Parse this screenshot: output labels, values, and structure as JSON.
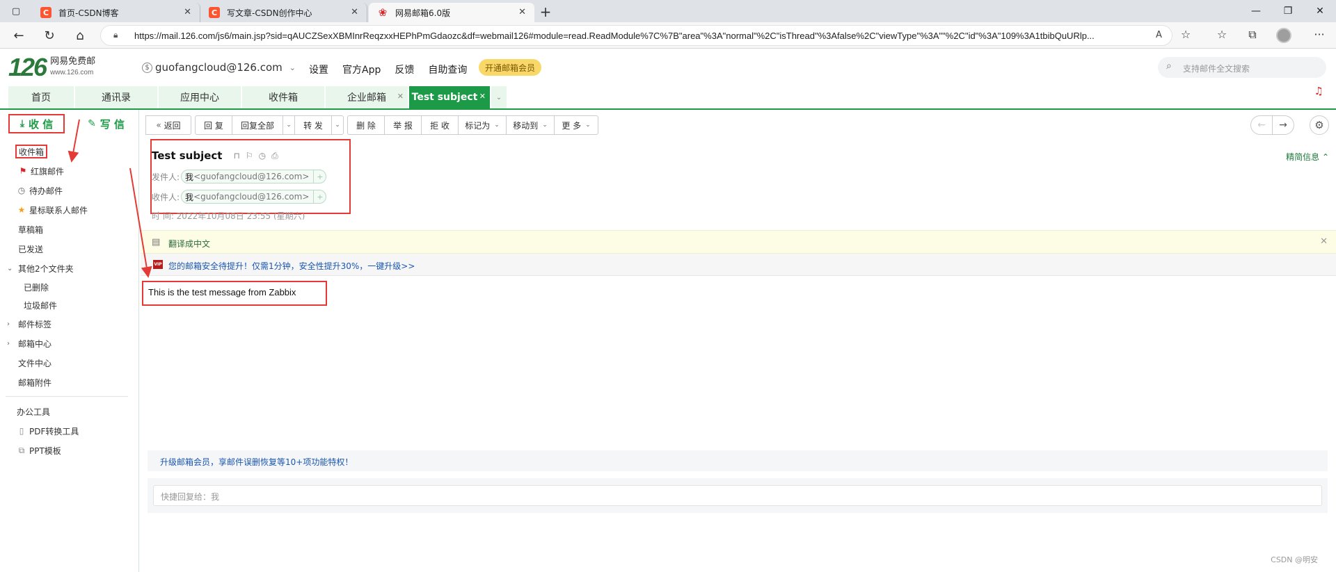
{
  "browser": {
    "tabs": [
      {
        "title": "首页-CSDN博客",
        "icon": "csdn-logo"
      },
      {
        "title": "写文章-CSDN创作中心",
        "icon": "csdn-logo"
      },
      {
        "title": "网易邮箱6.0版",
        "icon": "netease-mail-logo"
      }
    ],
    "url": "https://mail.126.com/js6/main.jsp?sid=qAUCZSexXBMInrReqzxxHEPhPmGdaozc&df=webmail126#module=read.ReadModule%7C%7B\"area\"%3A\"normal\"%2C\"isThread\"%3Afalse%2C\"viewType\"%3A\"\"%2C\"id\"%3A\"109%3A1tbibQuURlp...",
    "read_aloud_label": "Aͅ"
  },
  "header": {
    "logo_number": "126",
    "logo_name": "网易免费邮",
    "logo_domain": "www.126.com",
    "account": "guofangcloud@126.com",
    "links": [
      "设置",
      "官方App",
      "反馈",
      "自助查询"
    ],
    "vip_button": "开通邮箱会员",
    "search_placeholder": "支持邮件全文搜索"
  },
  "main_tabs": [
    {
      "label": "首页"
    },
    {
      "label": "通讯录"
    },
    {
      "label": "应用中心"
    },
    {
      "label": "收件箱"
    },
    {
      "label": "企业邮箱"
    },
    {
      "label": "Test subject"
    }
  ],
  "sidebar": {
    "receive": "收 信",
    "write": "写 信",
    "folders": [
      {
        "label": "收件箱"
      },
      {
        "label": "红旗邮件"
      },
      {
        "label": "待办邮件"
      },
      {
        "label": "星标联系人邮件"
      },
      {
        "label": "草稿箱"
      },
      {
        "label": "已发送"
      },
      {
        "label": "其他2个文件夹"
      },
      {
        "label": "已删除"
      },
      {
        "label": "垃圾邮件"
      },
      {
        "label": "邮件标签"
      },
      {
        "label": "邮箱中心"
      },
      {
        "label": "文件中心"
      },
      {
        "label": "邮箱附件"
      }
    ],
    "tools": [
      {
        "label": "办公工具"
      },
      {
        "label": "PDF转换工具"
      },
      {
        "label": "PPT模板"
      }
    ]
  },
  "toolbar": {
    "back": "返回",
    "reply": "回 复",
    "reply_all": "回复全部",
    "forward": "转 发",
    "delete": "删 除",
    "report": "举 报",
    "reject": "拒 收",
    "mark_as": "标记为",
    "move_to": "移动到",
    "more": "更 多"
  },
  "mail": {
    "subject": "Test subject",
    "simple_info": "精简信息",
    "from_label": "发件人:",
    "to_label": "收件人:",
    "sender_name": "我",
    "sender_email": "<guofangcloud@126.com>",
    "recipient_name": "我",
    "recipient_email": "<guofangcloud@126.com>",
    "time": "时  间:  2022年10月08日 23:55 (星期六)",
    "translate": "翻译成中文",
    "security_notice": "您的邮箱安全待提升！仅需1分钟，安全性提升30%，一键升级>>",
    "body": "This is the test message from Zabbix",
    "upgrade_notice": "升级邮箱会员，享邮件误删恢复等10+项功能特权！",
    "quick_reply_placeholder": "快捷回复给：我"
  },
  "watermark": "CSDN @明安",
  "colors": {
    "brand_green": "#1d9a47",
    "annotation_red": "#e53935",
    "vip_yellow": "#f9d86a"
  }
}
